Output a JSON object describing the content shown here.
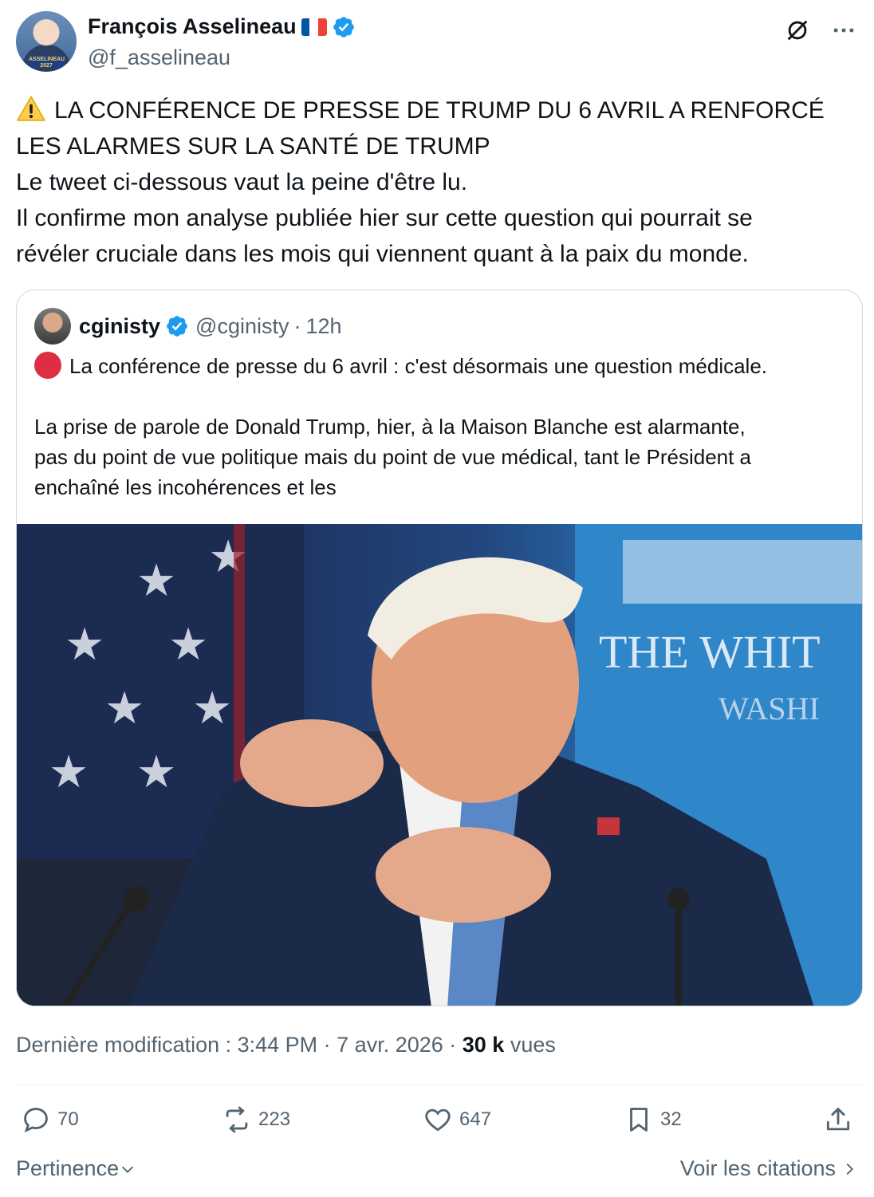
{
  "author": {
    "name": "François Asselineau",
    "handle": "@f_asselineau",
    "avatar_badge": "ASSELINEAU 2027"
  },
  "tweet": {
    "lines": [
      "LA CONFÉRENCE DE PRESSE DE TRUMP DU 6 AVRIL A RENFORCÉ",
      "LES ALARMES SUR LA SANTÉ DE TRUMP",
      "Le tweet ci-dessous vaut la peine d'être lu.",
      "Il confirme mon analyse publiée hier sur cette question qui pourrait se",
      "révéler cruciale dans les mois qui viennent quant à la paix du monde."
    ]
  },
  "quote": {
    "name": "cginisty",
    "handle": "@cginisty",
    "separator": "·",
    "time": "12h",
    "line1": "La conférence de presse du 6 avril : c'est désormais une question médicale.",
    "line2": "La prise de parole de Donald Trump, hier, à la Maison Blanche est alarmante,",
    "line3": "pas du point de vue politique mais du point de vue médical, tant le Président a",
    "line4": "enchaîné les incohérences et les",
    "image_backdrop_text_1": "THE WHIT",
    "image_backdrop_text_2": "WASHI"
  },
  "meta": {
    "prefix": "Dernière modification : 3:44 PM · 7 avr. 2026 · ",
    "views_count": "30 k",
    "views_label": " vues"
  },
  "actions": {
    "replies": "70",
    "reposts": "223",
    "likes": "647",
    "bookmarks": "32"
  },
  "footer": {
    "sort_label": "Pertinence",
    "quotes_link": "Voir les citations"
  },
  "colors": {
    "verified": "#1d9bf0",
    "text": "#0f1419",
    "secondary": "#536471",
    "red_dot": "#dd2e44"
  }
}
